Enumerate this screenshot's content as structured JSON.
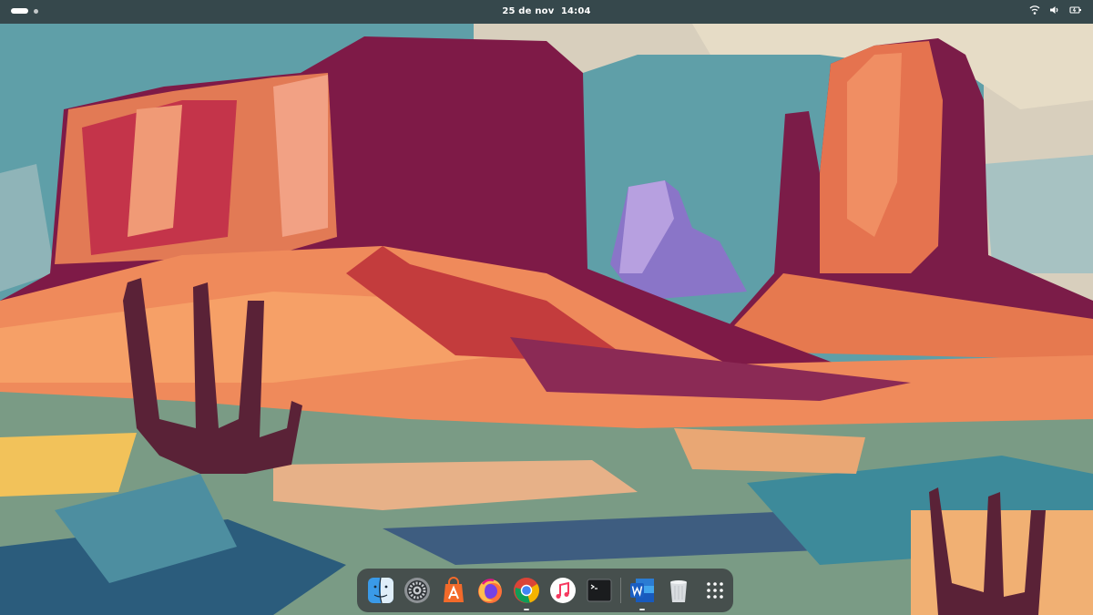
{
  "topbar": {
    "date": "25 de nov",
    "time": "14:04",
    "activities_icon": "activities-pill-icon",
    "workspace_icon": "workspace-dot-icon",
    "tray_icons": [
      "wifi-icon",
      "volume-icon",
      "battery-icon"
    ]
  },
  "dock": {
    "apps": [
      {
        "icon": "finder-icon"
      },
      {
        "icon": "system-settings-icon"
      },
      {
        "icon": "app-store-icon"
      },
      {
        "icon": "firefox-icon"
      },
      {
        "icon": "chrome-icon",
        "running": true
      },
      {
        "icon": "music-icon"
      },
      {
        "icon": "terminal-icon"
      },
      {
        "icon": "word-icon",
        "running": true
      },
      {
        "icon": "trash-icon"
      },
      {
        "icon": "app-grid-icon"
      }
    ]
  },
  "colors": {
    "topbar_bg": "#303a3c",
    "dock_bg": "#373a3e",
    "sky": "#5f9fa8",
    "mesa_shadow": "#7e1a47",
    "mesa_light": "#e6794f"
  }
}
